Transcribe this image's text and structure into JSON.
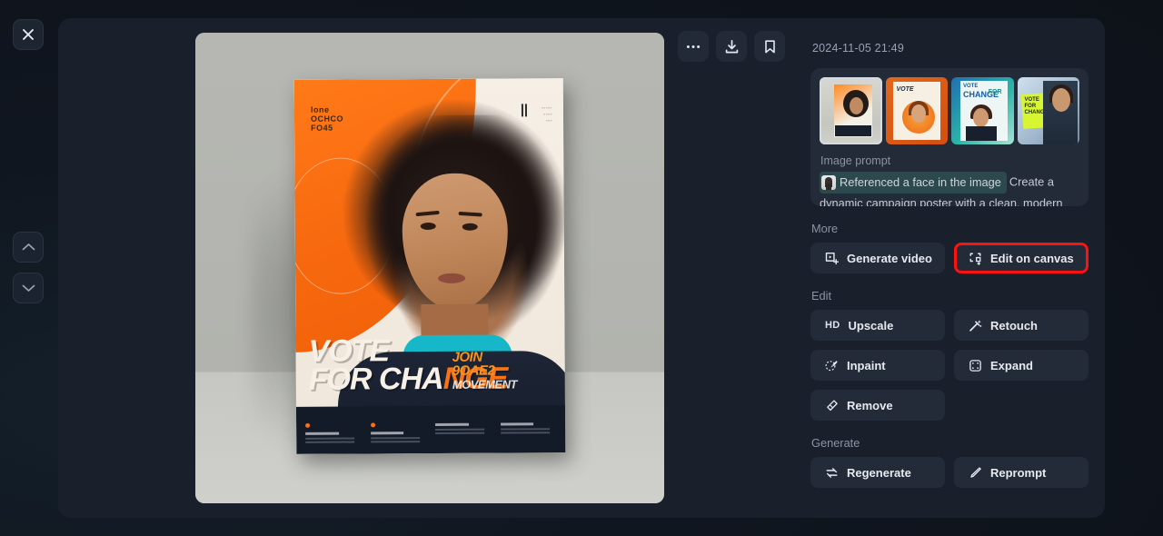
{
  "rail": {
    "close_icon": "close-icon",
    "prev_icon": "chevron-up-icon",
    "next_icon": "chevron-down-icon"
  },
  "toolbar": {
    "more_label": "More options",
    "download_label": "Download",
    "bookmark_label": "Bookmark"
  },
  "detail": {
    "timestamp": "2024-11-05 21:49",
    "prompt_label": "Image prompt",
    "face_chip": "Referenced a face in the image",
    "prompt_text": "Create a dynamic campaign poster with a clean, modern backgr"
  },
  "thumbnails": [
    {
      "name": "thumbnail-1",
      "selected": true
    },
    {
      "name": "thumbnail-2",
      "selected": false
    },
    {
      "name": "thumbnail-3",
      "selected": false
    },
    {
      "name": "thumbnail-4",
      "selected": false
    }
  ],
  "sections": {
    "more": {
      "label": "More",
      "generate_video": "Generate video",
      "edit_on_canvas": "Edit on canvas"
    },
    "edit": {
      "label": "Edit",
      "upscale": "Upscale",
      "upscale_icon_text": "HD",
      "retouch": "Retouch",
      "inpaint": "Inpaint",
      "expand": "Expand",
      "remove": "Remove"
    },
    "generate": {
      "label": "Generate",
      "regenerate": "Regenerate",
      "reprompt": "Reprompt"
    }
  },
  "poster": {
    "title_line1": "VOTE",
    "title_line2_a": "FOR CHA",
    "title_line2_b": "NGE",
    "sub_line1": "JOIN",
    "sub_line2": "9OAE2",
    "sub_line3": "MOVEMENT",
    "badge_line1": "lone",
    "badge_line2": "OCHCO",
    "badge_line3": "FO45"
  },
  "colors": {
    "highlight": "#fd1111",
    "accent_orange": "#f97316",
    "chip_bg": "#2c4a4d",
    "panel_bg": "#1a202b",
    "button_bg": "#232b38"
  }
}
